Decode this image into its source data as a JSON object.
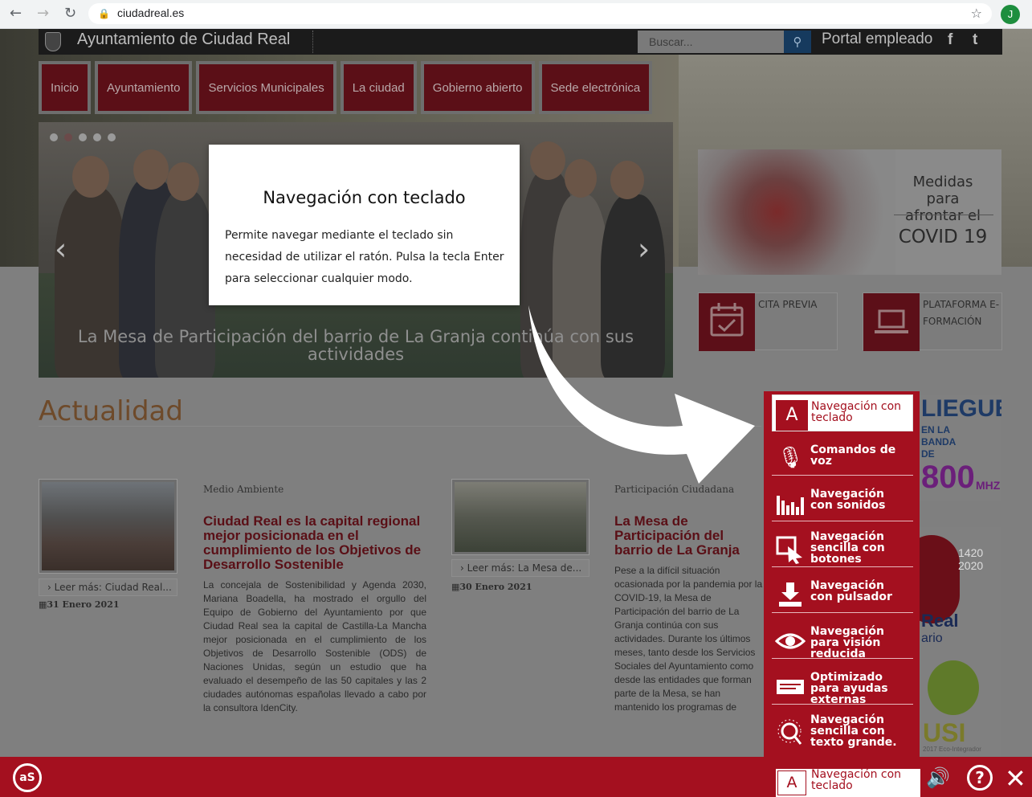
{
  "browser": {
    "url": "ciudadreal.es",
    "profile_initial": "J"
  },
  "header": {
    "site_title": "Ayuntamiento de Ciudad Real",
    "search_placeholder": "Buscar...",
    "portal_label": "Portal empleado",
    "facebook": "f",
    "twitter": "t"
  },
  "nav": {
    "items": [
      "Inicio",
      "Ayuntamiento",
      "Servicios Municipales",
      "La ciudad",
      "Gobierno abierto",
      "Sede electrónica"
    ]
  },
  "slider": {
    "caption": "La Mesa de Participación del barrio de La Granja continúa con sus actividades",
    "prev": "‹",
    "next": "›"
  },
  "covid": {
    "line1": "Medidas para afrontar el",
    "line2": "COVID 19"
  },
  "quick_links": [
    {
      "label": "CITA PREVIA"
    },
    {
      "label": "PLATAFORMA E-FORMACIÓN"
    }
  ],
  "actualidad": {
    "title": "Actualidad",
    "articles": [
      {
        "category": "Medio Ambiente",
        "headline": "Ciudad Real es la capital regional mejor posicionada en el cumplimiento de los Objetivos de Desarrollo Sostenible",
        "body": "La concejala de Sostenibilidad y Agenda 2030, Mariana Boadella, ha mostrado el orgullo del Equipo de Gobierno del Ayuntamiento por que Ciudad Real sea la capital de Castilla-La Mancha mejor posicionada en el cumplimiento de los Objetivos de Desarrollo Sostenible (ODS) de Naciones Unidas, según un estudio que ha evaluado el desempeño de las 50 capitales y las 2 ciudades autónomas españolas llevado a cabo por la consultora IdenCity.",
        "readmore": "Leer más: Ciudad Real...",
        "date": "31 Enero 2021"
      },
      {
        "category": "Participación Ciudadana",
        "headline": "La Mesa de Participación del barrio de La Granja continúa con sus actividades",
        "body": "Pese a la difícil situación ocasionada por la pandemia por la COVID-19, la Mesa de Participación del barrio de La Granja continúa con sus actividades. Durante los últimos meses, tanto desde los Servicios Sociales del Ayuntamiento como desde las entidades que forman parte de la Mesa, se han mantenido los programas de refuerzo educativo, actividades de ocio y tiempo libre, reparto de mascarillas y geles, así como la actividad en el Centro Social de la Granja.",
        "readmore": "Leer más: La Mesa de...",
        "date": "30 Enero 2021"
      }
    ]
  },
  "side_ads": {
    "despliegue": "LIEGUE",
    "banda_small": "EN LA BANDA DE",
    "mhz_big": "800",
    "mhz_unit": "MHZ",
    "years_1": "1420",
    "years_2": "2020",
    "real": "Real",
    "ario": "ario",
    "dusi": "USI",
    "dusi_sub": "2017 Eco-Integrador"
  },
  "tooltip": {
    "title": "Navegación con teclado",
    "text": "Permite navegar mediante el teclado sin necesidad de utilizar el ratón. Pulsa la tecla Enter para seleccionar cualquier modo."
  },
  "access_menu": {
    "items": [
      {
        "icon": "A",
        "label": "Navegación con teclado"
      },
      {
        "icon": "🎙",
        "label": "Comandos de voz"
      },
      {
        "icon": "▮",
        "label": "Navegación con sonidos"
      },
      {
        "icon": "⬚",
        "label": "Navegación sencilla con botones"
      },
      {
        "icon": "⬇",
        "label": "Navegación con pulsador"
      },
      {
        "icon": "◉",
        "label": "Navegación para visión reducida"
      },
      {
        "icon": "▤",
        "label": "Optimizado para ayudas externas"
      },
      {
        "icon": "✺",
        "label": "Navegación sencilla con texto grande."
      }
    ]
  },
  "bottom_bar": {
    "logo_text": "aS",
    "current_icon": "A",
    "current_label": "Navegación con teclado",
    "sound_icon": "🔊",
    "help_icon": "?",
    "close_icon": "✕"
  }
}
